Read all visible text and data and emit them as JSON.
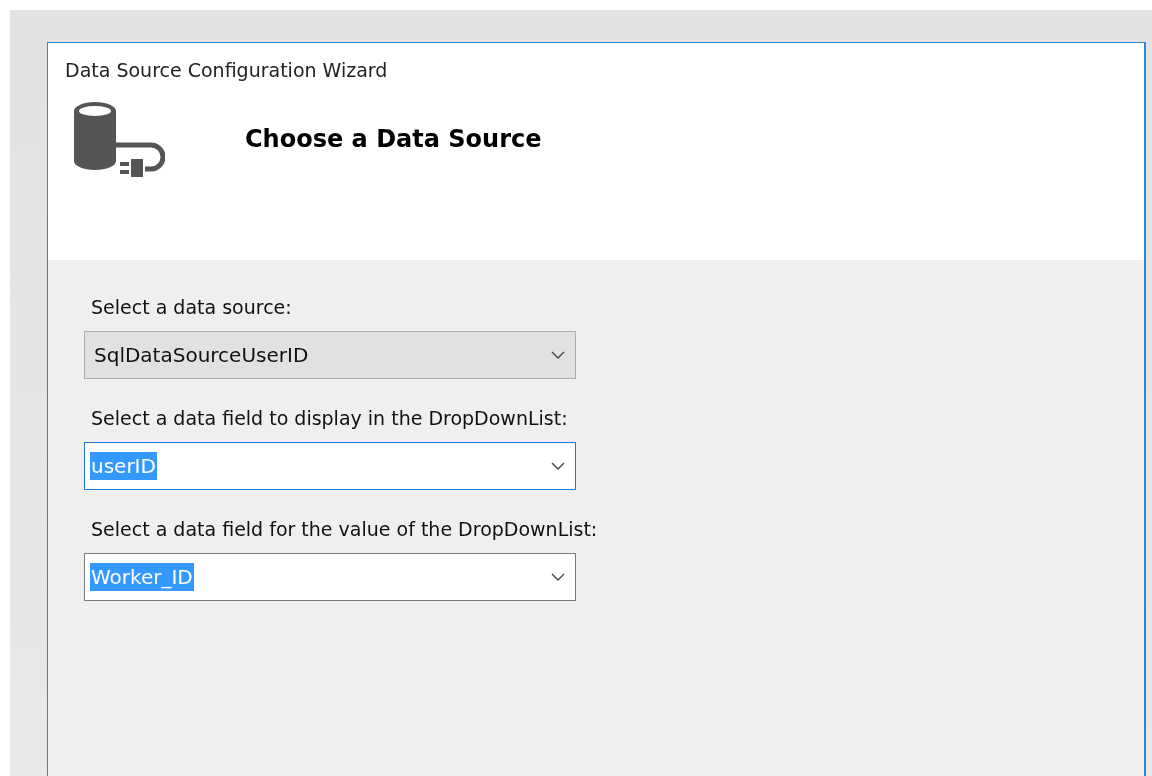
{
  "window": {
    "title": "Data Source Configuration Wizard"
  },
  "header": {
    "title": "Choose a Data Source"
  },
  "fields": [
    {
      "label": "Select a data source:",
      "value": "SqlDataSourceUserID",
      "kind": "readonly",
      "focused": false,
      "text_selected": false
    },
    {
      "label": "Select a data field to display in the DropDownList:",
      "value": "userID",
      "kind": "editable",
      "focused": true,
      "text_selected": true
    },
    {
      "label": "Select a data field for the value of the DropDownList:",
      "value": "Worker_ID",
      "kind": "editable",
      "focused": false,
      "text_selected": true
    }
  ]
}
